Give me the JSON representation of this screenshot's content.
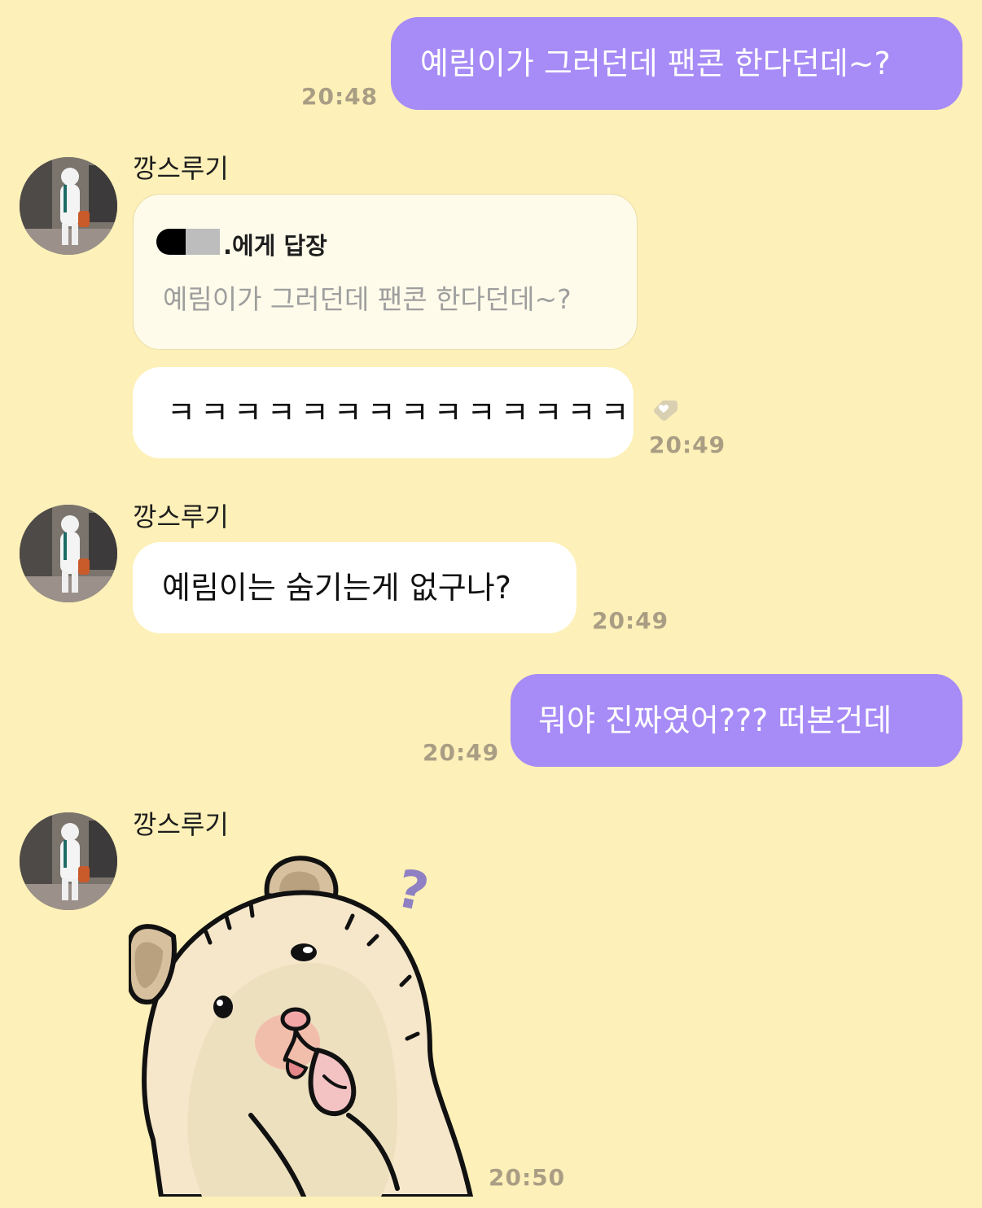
{
  "colors": {
    "background": "#fdf0b8",
    "outgoing_bubble": "#a78bf6",
    "incoming_bubble": "#ffffff",
    "reply_card": "#fffbea",
    "timestamp": "#a99e84"
  },
  "messages": {
    "m1": {
      "text": "예림이가 그러던데 팬콘 한다던데~?",
      "time": "20:48"
    },
    "m2": {
      "sender": "깡스루기",
      "reply_to_suffix": ".에게 답장",
      "quoted": "예림이가 그러던데 팬콘 한다던데~?",
      "text": "ㅋㅋㅋㅋㅋㅋㅋㅋㅋㅋㅋㅋㅋㅋ",
      "time": "20:49",
      "reaction_icon": "heart-tag-icon"
    },
    "m3": {
      "sender": "깡스루기",
      "text": "예림이는 숨기는게 없구나?",
      "time": "20:49"
    },
    "m4": {
      "text": "뭐야 진짜였어??? 떠본건데",
      "time": "20:49"
    },
    "m5": {
      "sender": "깡스루기",
      "sticker": "hamster-question-sticker",
      "question_mark": "?",
      "time": "20:50"
    }
  }
}
